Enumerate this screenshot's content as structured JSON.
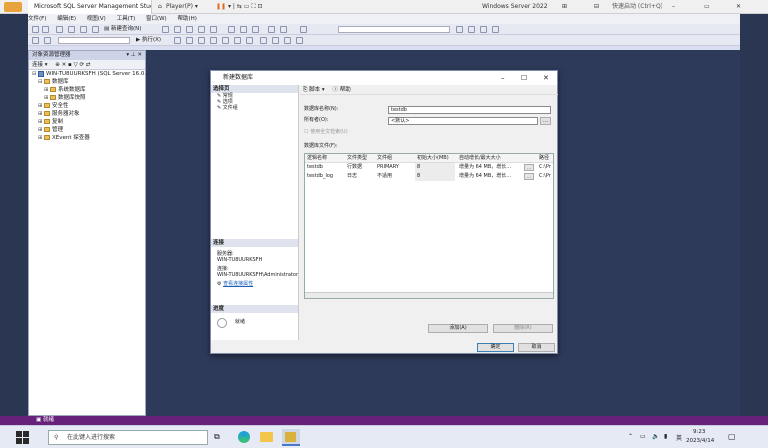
{
  "vm": {
    "tab_title": "Microsoft SQL Server Management Studio",
    "player_label": "Player(P)",
    "vm_name": "Windows Server 2022",
    "search_placeholder": "快速启动 (Ctrl+Q)"
  },
  "menu": [
    "文件(F)",
    "编辑(E)",
    "视图(V)",
    "工具(T)",
    "窗口(W)",
    "帮助(H)"
  ],
  "toolbar": {
    "new_query": "新建查询(N)",
    "execute": "执行(X)"
  },
  "object_explorer": {
    "title": "对象资源管理器",
    "connect_label": "连接",
    "items": [
      {
        "toggle": "⊟",
        "label": "WIN-TU8UURKSFH (SQL Server 16.0.",
        "indent": 0,
        "icon": "server"
      },
      {
        "toggle": "⊟",
        "label": "数据库",
        "indent": 1,
        "icon": "folder"
      },
      {
        "toggle": "⊞",
        "label": "系统数据库",
        "indent": 2,
        "icon": "folder"
      },
      {
        "toggle": "⊞",
        "label": "数据库快照",
        "indent": 2,
        "icon": "folder"
      },
      {
        "toggle": "⊞",
        "label": "安全性",
        "indent": 1,
        "icon": "folder"
      },
      {
        "toggle": "⊞",
        "label": "服务器对象",
        "indent": 1,
        "icon": "folder"
      },
      {
        "toggle": "⊞",
        "label": "复制",
        "indent": 1,
        "icon": "folder"
      },
      {
        "toggle": "⊞",
        "label": "管理",
        "indent": 1,
        "icon": "folder"
      },
      {
        "toggle": "⊞",
        "label": "XEvent 探查器",
        "indent": 1,
        "icon": "xevent"
      }
    ]
  },
  "status": "就绪",
  "dialog": {
    "title": "新建数据库",
    "select_page_header": "选择页",
    "pages": [
      "常规",
      "选项",
      "文件组"
    ],
    "connection_header": "连接",
    "server_label": "服务器:",
    "server_value": "WIN-TU8UURKSFH",
    "connection_label": "连接:",
    "connection_value": "WIN-TU8UURKSFH\\Administrator",
    "view_props_link": "查看连接属性",
    "progress_header": "进度",
    "progress_status": "就绪",
    "toolbar_script": "脚本",
    "toolbar_help": "帮助",
    "db_name_label": "数据库名称(N):",
    "db_name_value": "testdb",
    "owner_label": "所有者(O):",
    "owner_value": "<默认>",
    "fulltext_label": "使用全文检索(U)",
    "files_label": "数据库文件(F):",
    "columns": [
      "逻辑名称",
      "文件类型",
      "文件组",
      "初始大小(MB)",
      "自动增长/最大大小",
      "路径"
    ],
    "rows": [
      [
        "testdb",
        "行数据",
        "PRIMARY",
        "8",
        "增量为 64 MB，增长...",
        "C:\\Pr"
      ],
      [
        "testdb_log",
        "日志",
        "不适用",
        "8",
        "增量为 64 MB，增长...",
        "C:\\Pr"
      ]
    ],
    "add_button": "添加(A)",
    "remove_button": "删除(R)",
    "ok_button": "确定",
    "cancel_button": "取消"
  },
  "taskbar": {
    "search_placeholder": "在此键入进行搜索",
    "ime": "英",
    "time": "9:23",
    "date": "2023/4/14"
  }
}
